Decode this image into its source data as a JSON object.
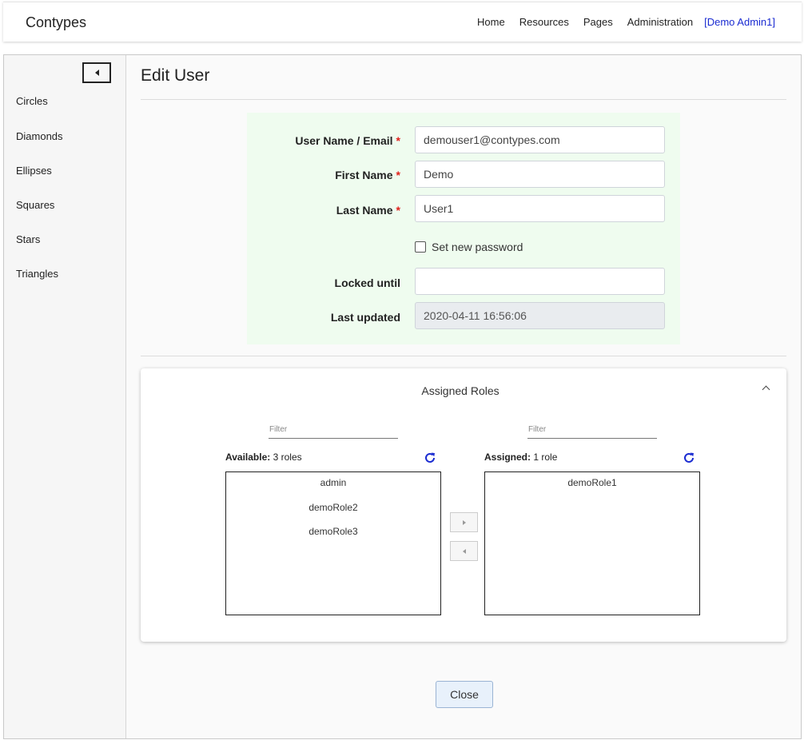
{
  "header": {
    "brand": "Contypes",
    "nav": [
      "Home",
      "Resources",
      "Pages",
      "Administration"
    ],
    "user": "[Demo Admin1]"
  },
  "sidebar": {
    "collapse_icon": "caret-left-icon",
    "items": [
      "Circles",
      "Diamonds",
      "Ellipses",
      "Squares",
      "Stars",
      "Triangles"
    ]
  },
  "page": {
    "title": "Edit User"
  },
  "form": {
    "fields": {
      "username": {
        "label": "User Name / Email",
        "value": "demouser1@contypes.com",
        "required": true
      },
      "first_name": {
        "label": "First Name",
        "value": "Demo",
        "required": true
      },
      "last_name": {
        "label": "Last Name",
        "value": "User1",
        "required": true
      },
      "locked_until": {
        "label": "Locked until",
        "value": ""
      },
      "last_updated": {
        "label": "Last updated",
        "value": "2020-04-11 16:56:06"
      }
    },
    "required_mark": "*",
    "set_password": {
      "label": "Set new password",
      "checked": false
    }
  },
  "roles": {
    "title": "Assigned Roles",
    "available": {
      "filter_placeholder": "Filter",
      "label": "Available:",
      "count": "3 roles",
      "items": [
        "admin",
        "demoRole2",
        "demoRole3"
      ]
    },
    "assigned": {
      "filter_placeholder": "Filter",
      "label": "Assigned:",
      "count": "1 role",
      "items": [
        "demoRole1"
      ]
    }
  },
  "actions": {
    "close_label": "Close"
  },
  "colors": {
    "link": "#1a2bd1",
    "required": "#e0201a",
    "form_bg": "#effcef",
    "refresh_icon": "#1a2bd1"
  }
}
